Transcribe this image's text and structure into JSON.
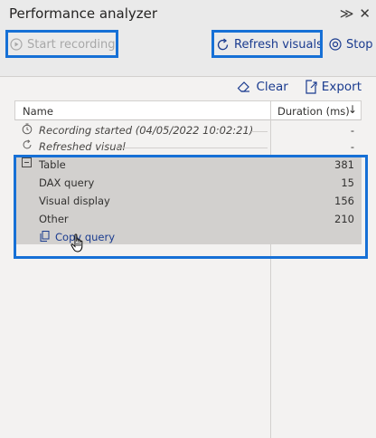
{
  "header": {
    "title": "Performance analyzer",
    "expand_icon": "double-chevron-right-icon",
    "close_icon": "close-icon"
  },
  "toolbar": {
    "start_recording_label": "Start recording",
    "refresh_visuals_label": "Refresh visuals",
    "stop_label": "Stop"
  },
  "actions": {
    "clear_label": "Clear",
    "export_label": "Export"
  },
  "table": {
    "col_name": "Name",
    "col_duration": "Duration (ms)",
    "rows": [
      {
        "name": "Recording started (04/05/2022 10:02:21)",
        "value": "-"
      },
      {
        "name": "Refreshed visual",
        "value": "-"
      },
      {
        "name": "Table",
        "value": "381"
      },
      {
        "name": "DAX query",
        "value": "15"
      },
      {
        "name": "Visual display",
        "value": "156"
      },
      {
        "name": "Other",
        "value": "210"
      }
    ],
    "copy_query_label": "Copy query"
  },
  "colors": {
    "accent": "#1670d6",
    "link": "#1a3b8f",
    "selected_bg": "#d2d0ce"
  }
}
